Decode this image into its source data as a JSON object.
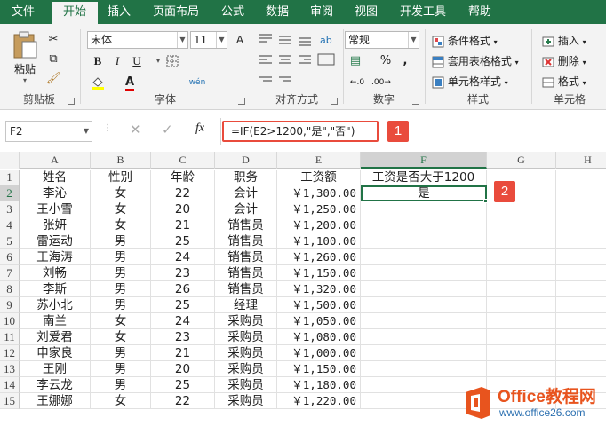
{
  "tabs": [
    "文件",
    "开始",
    "插入",
    "页面布局",
    "公式",
    "数据",
    "审阅",
    "视图",
    "开发工具",
    "帮助"
  ],
  "active_tab": "开始",
  "ribbon": {
    "clipboard": {
      "paste_label": "粘贴",
      "group_label": "剪贴板"
    },
    "font": {
      "font_name": "宋体",
      "font_size": "11",
      "bold": "B",
      "italic": "I",
      "underline": "U",
      "grow": "A",
      "shrink": "A",
      "wen": "wén",
      "font_color_letter": "A",
      "group_label": "字体"
    },
    "alignment": {
      "group_label": "对齐方式"
    },
    "number": {
      "format": "常规",
      "percent": "%",
      "comma": ",",
      "group_label": "数字"
    },
    "styles": {
      "conditional": "条件格式",
      "table": "套用表格格式",
      "cell": "单元格样式",
      "group_label": "样式"
    },
    "cells": {
      "insert": "插入",
      "delete": "删除",
      "format": "格式",
      "group_label": "单元格"
    }
  },
  "formula_bar": {
    "name_box": "F2",
    "fx": "fx",
    "formula": "=IF(E2>1200,\"是\",\"否\")",
    "callout_1": "1",
    "callout_2": "2"
  },
  "columns": [
    "A",
    "B",
    "C",
    "D",
    "E",
    "F",
    "G",
    "H"
  ],
  "selected_cell": "F2",
  "table": {
    "headers": [
      "姓名",
      "性别",
      "年龄",
      "职务",
      "工资额",
      "工资是否大于1200"
    ],
    "rows": [
      [
        "李沁",
        "女",
        "22",
        "会计",
        "￥1,300.00",
        "是"
      ],
      [
        "王小雪",
        "女",
        "20",
        "会计",
        "￥1,250.00",
        ""
      ],
      [
        "张妍",
        "女",
        "21",
        "销售员",
        "￥1,200.00",
        ""
      ],
      [
        "雷运动",
        "男",
        "25",
        "销售员",
        "￥1,100.00",
        ""
      ],
      [
        "王海涛",
        "男",
        "24",
        "销售员",
        "￥1,260.00",
        ""
      ],
      [
        "刘畅",
        "男",
        "23",
        "销售员",
        "￥1,150.00",
        ""
      ],
      [
        "李斯",
        "男",
        "26",
        "销售员",
        "￥1,320.00",
        ""
      ],
      [
        "苏小北",
        "男",
        "25",
        "经理",
        "￥1,500.00",
        ""
      ],
      [
        "南兰",
        "女",
        "24",
        "采购员",
        "￥1,050.00",
        ""
      ],
      [
        "刘爱君",
        "女",
        "23",
        "采购员",
        "￥1,080.00",
        ""
      ],
      [
        "申家良",
        "男",
        "21",
        "采购员",
        "￥1,000.00",
        ""
      ],
      [
        "王刚",
        "男",
        "20",
        "采购员",
        "￥1,150.00",
        ""
      ],
      [
        "李云龙",
        "男",
        "25",
        "采购员",
        "￥1,180.00",
        ""
      ],
      [
        "王娜娜",
        "女",
        "22",
        "采购员",
        "￥1,220.00",
        ""
      ]
    ]
  },
  "watermark": {
    "brand": "Office教程网",
    "url": "www.office26.com"
  },
  "colors": {
    "excel_green": "#217346",
    "callout_red": "#e94b3c",
    "watermark_orange": "#e8541e"
  }
}
